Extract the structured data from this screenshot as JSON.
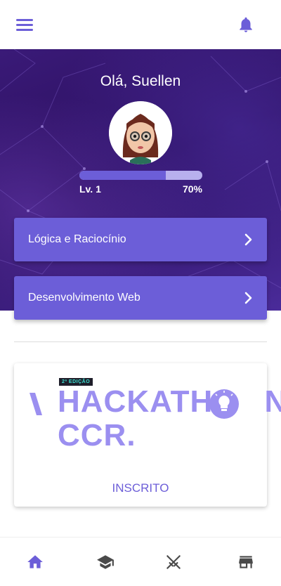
{
  "header": {
    "menu_icon": "menu-icon",
    "notification_icon": "bell-icon"
  },
  "profile": {
    "greeting": "Olá, Suellen",
    "level_label": "Lv. 1",
    "progress_label": "70%",
    "progress_fraction": 0.7
  },
  "courses": [
    {
      "label": "Lógica e Raciocínio",
      "icon": "chevron-right-icon"
    },
    {
      "label": "Desenvolvimento Web",
      "icon": "chevron-right-icon"
    }
  ],
  "event_card": {
    "edition": "2ª EDIÇÃO",
    "title_line1": "HACKATHO",
    "title_line1_end": "N",
    "title_line2": "CCR.",
    "status": "INSCRITO"
  },
  "bottom_nav": [
    {
      "icon": "home-icon",
      "active": true
    },
    {
      "icon": "graduation-cap-icon",
      "active": false
    },
    {
      "icon": "crossed-swords-icon",
      "active": false
    },
    {
      "icon": "store-icon",
      "active": false
    }
  ],
  "colors": {
    "accent": "#6c5ed8",
    "hero_bg": "#2b0f5e",
    "inactive_icon": "#4a4a4a",
    "logo_purple": "#9b8ff0"
  }
}
